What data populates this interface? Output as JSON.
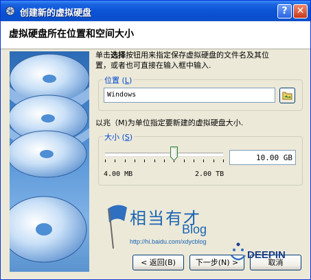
{
  "window": {
    "title": "创建新的虚拟硬盘",
    "help_label": "?",
    "close_label": "✕"
  },
  "header": {
    "title": "虚拟硬盘所在位置和空间大小"
  },
  "description": {
    "line1_a": "单击",
    "line1_bold": "选择",
    "line1_b": "按钮用来指定保存虚拟硬盘的文件名及其位",
    "line2": "置，或者也可直接在输入框中输入."
  },
  "location": {
    "legend": "位置",
    "accel": "L",
    "value": "Windows"
  },
  "size_hint": "以兆（M)为单位指定要新建的虚拟硬盘大小.",
  "size": {
    "legend": "大小",
    "accel": "S",
    "value": "10.00 GB",
    "slider_fraction": 0.58,
    "tick_count": 13,
    "min_label": "4.00 MB",
    "max_label": "2.00 TB"
  },
  "buttons": {
    "back": "< 返回(B)",
    "next": "下一步(N) >",
    "cancel": "取消"
  },
  "watermark": {
    "cn": "相当有才",
    "blog": "Blog",
    "url": "http://hi.baidu.com/xdycblog",
    "deepin": "DEEPIN"
  },
  "colors": {
    "titlebar": "#0b55d6",
    "legend": "#0046d5",
    "panel": "#4e8ed4",
    "watermark_blue": "#1a64b4"
  },
  "icons": [
    "virtualbox-icon",
    "help-icon",
    "close-icon",
    "folder-select-icon",
    "slider-thumb-icon",
    "disks-illustration",
    "flag-logo-icon",
    "deepin-logo-icon"
  ]
}
